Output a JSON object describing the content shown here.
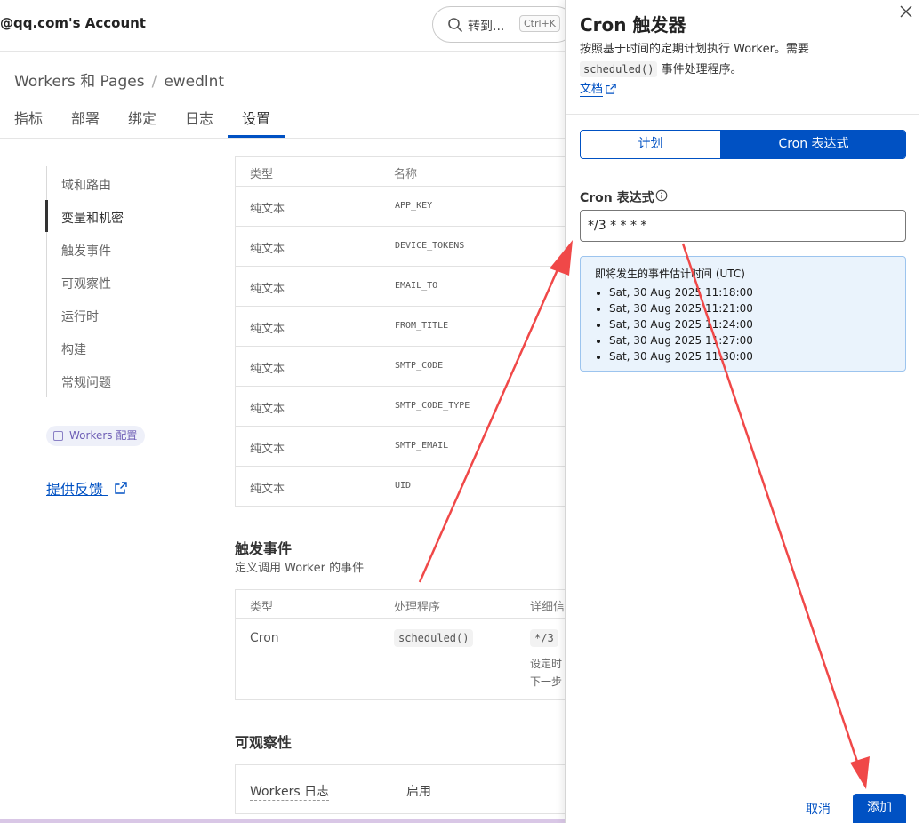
{
  "header": {
    "account": "@qq.com's Account",
    "search_text": "转到...",
    "search_shortcut": "Ctrl+K"
  },
  "breadcrumb": {
    "parent": "Workers 和 Pages",
    "separator": "/",
    "current": "ewedlnt"
  },
  "tabs": [
    {
      "label": "指标"
    },
    {
      "label": "部署"
    },
    {
      "label": "绑定"
    },
    {
      "label": "日志"
    },
    {
      "label": "设置",
      "active": true
    }
  ],
  "sidenav": {
    "items": [
      {
        "label": "域和路由"
      },
      {
        "label": "变量和机密",
        "active": true
      },
      {
        "label": "触发事件"
      },
      {
        "label": "可观察性"
      },
      {
        "label": "运行时"
      },
      {
        "label": "构建"
      },
      {
        "label": "常规问题"
      }
    ],
    "workers_config": "Workers 配置",
    "feedback": "提供反馈"
  },
  "variables_table": {
    "headers": [
      "类型",
      "名称"
    ],
    "rows": [
      {
        "type": "纯文本",
        "name": "APP_KEY"
      },
      {
        "type": "纯文本",
        "name": "DEVICE_TOKENS"
      },
      {
        "type": "纯文本",
        "name": "EMAIL_TO"
      },
      {
        "type": "纯文本",
        "name": "FROM_TITLE"
      },
      {
        "type": "纯文本",
        "name": "SMTP_CODE"
      },
      {
        "type": "纯文本",
        "name": "SMTP_CODE_TYPE"
      },
      {
        "type": "纯文本",
        "name": "SMTP_EMAIL"
      },
      {
        "type": "纯文本",
        "name": "UID"
      }
    ]
  },
  "triggers": {
    "title": "触发事件",
    "subtitle": "定义调用 Worker 的事件",
    "headers": [
      "类型",
      "处理程序",
      "详细信"
    ],
    "row": {
      "type": "Cron",
      "handler": "scheduled()",
      "detail": "*/3",
      "line2": "设定时",
      "line3": "下一步"
    }
  },
  "observability": {
    "title": "可观察性",
    "label": "Workers 日志",
    "value": "启用"
  },
  "drawer": {
    "title": "Cron 触发器",
    "desc_line1": "按照基于时间的定期计划执行 Worker。需要",
    "desc_code": "scheduled()",
    "desc_line2": "事件处理程序。",
    "docs_link": "文档",
    "segments": [
      "计划",
      "Cron 表达式"
    ],
    "active_segment": "Cron 表达式",
    "field_label": "Cron 表达式",
    "field_value": "*/3 * * * *",
    "preview_title": "即将发生的事件估计时间 (UTC)",
    "preview_items": [
      "Sat, 30 Aug 2025 11:18:00",
      "Sat, 30 Aug 2025 11:21:00",
      "Sat, 30 Aug 2025 11:24:00",
      "Sat, 30 Aug 2025 11:27:00",
      "Sat, 30 Aug 2025 11:30:00"
    ],
    "cancel": "取消",
    "add": "添加"
  },
  "colors": {
    "accent": "#0051c3",
    "annotation_arrow": "#f04848",
    "preview_bg": "#eaf3fc"
  }
}
